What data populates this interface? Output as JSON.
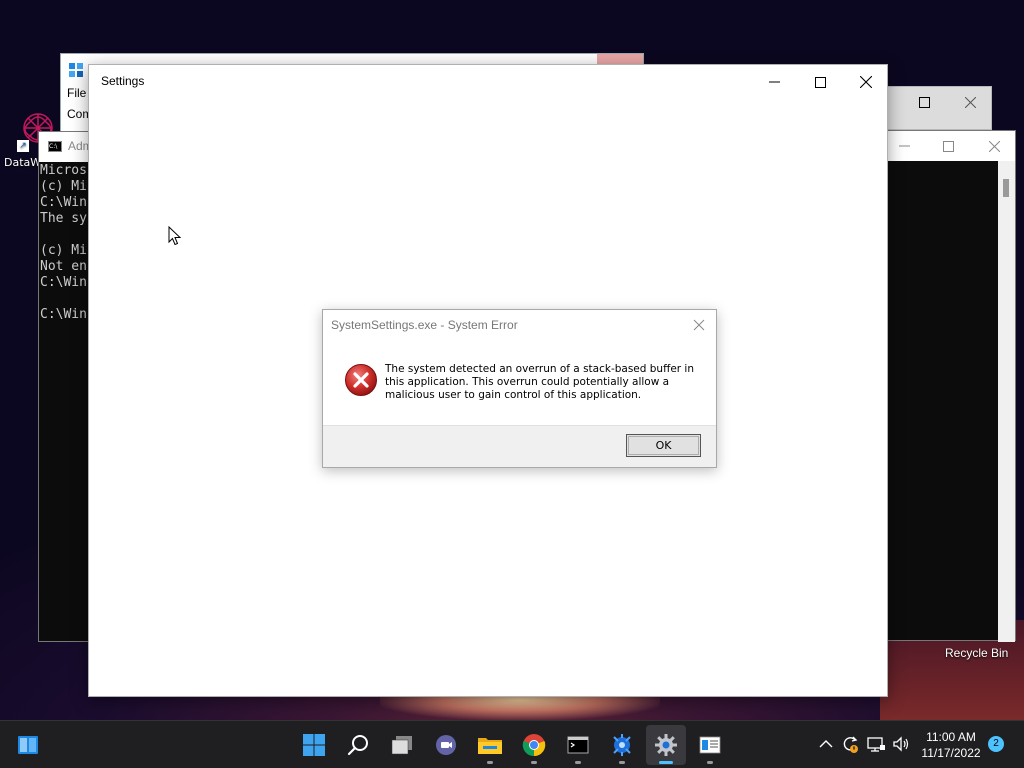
{
  "desktop": {
    "icons": [
      {
        "label": "DataW"
      },
      {
        "label": "Recycle Bin"
      }
    ]
  },
  "regedit": {
    "menu_label": "File",
    "address_label": "Com"
  },
  "cmd_window": {
    "title": "Adm",
    "lines": [
      "Micros",
      "(c) Mi",
      "C:\\Win",
      "The sy",
      "",
      "(c) Mi",
      "Not en",
      "C:\\Win",
      "",
      "C:\\Win"
    ]
  },
  "settings_window": {
    "title": "Settings"
  },
  "error_dialog": {
    "title": "SystemSettings.exe - System Error",
    "message": "The system detected an overrun of a stack-based buffer in this application. This overrun could potentially allow a malicious user to gain control of this application.",
    "ok_label": "OK"
  },
  "taskbar": {
    "apps": [
      {
        "name": "start-menu-button"
      },
      {
        "name": "windows-logo"
      },
      {
        "name": "search"
      },
      {
        "name": "task-view"
      },
      {
        "name": "teams-chat"
      },
      {
        "name": "file-explorer"
      },
      {
        "name": "chrome"
      },
      {
        "name": "terminal"
      },
      {
        "name": "app-blue"
      },
      {
        "name": "settings"
      },
      {
        "name": "registry-editor"
      }
    ],
    "clock": {
      "time": "11:00 AM",
      "date": "11/17/2022"
    },
    "notification_count": "2"
  },
  "colors": {
    "accent": "#4cc2ff",
    "error_red": "#c42b1c",
    "taskbar_bg": "#1f1f22"
  }
}
